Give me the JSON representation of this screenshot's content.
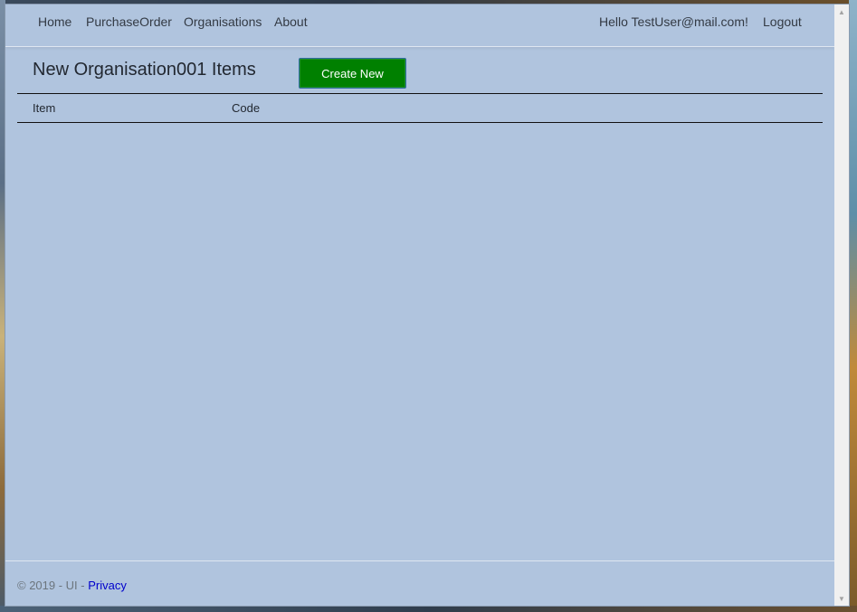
{
  "navbar": {
    "links": [
      {
        "label": "Home"
      },
      {
        "label": "PurchaseOrder"
      },
      {
        "label": "Organisations"
      },
      {
        "label": "About"
      }
    ],
    "greeting": "Hello TestUser@mail.com!",
    "logout_label": "Logout"
  },
  "main": {
    "title": "New Organisation001 Items",
    "create_button_label": "Create New",
    "table": {
      "columns": [
        "Item",
        "Code"
      ],
      "rows": []
    }
  },
  "footer": {
    "copyright": "© 2019 - UI - ",
    "privacy_label": "Privacy"
  },
  "colors": {
    "page_background": "#b0c4de",
    "create_button": "#008000",
    "link": "#0000cc"
  },
  "icons": {
    "scroll_up": "scroll-up-arrow-icon",
    "scroll_down": "scroll-down-arrow-icon"
  }
}
